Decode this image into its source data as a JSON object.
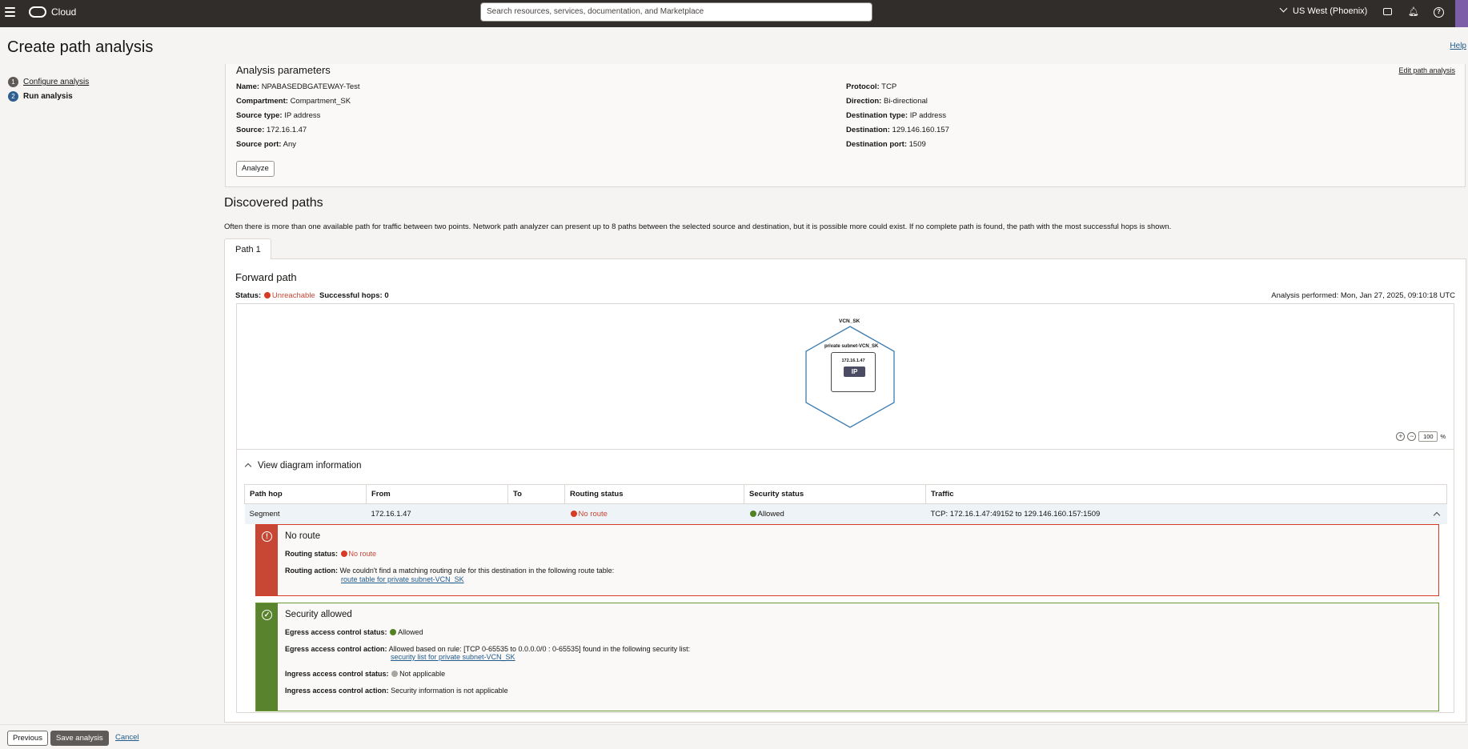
{
  "topbar": {
    "app_name": "Cloud",
    "search_placeholder": "Search resources, services, documentation, and Marketplace",
    "region": "US West (Phoenix)"
  },
  "page": {
    "title": "Create path analysis",
    "help_link": "Help"
  },
  "steps": [
    {
      "number": "1",
      "label": "Configure analysis"
    },
    {
      "number": "2",
      "label": "Run analysis"
    }
  ],
  "parameters": {
    "heading": "Analysis parameters",
    "edit_link": "Edit path analysis",
    "left": [
      {
        "label": "Name:",
        "value": "NPABASEDBGATEWAY-Test"
      },
      {
        "label": "Compartment:",
        "value": "Compartment_SK"
      },
      {
        "label": "Source type:",
        "value": "IP address"
      },
      {
        "label": "Source:",
        "value": "172.16.1.47"
      },
      {
        "label": "Source port:",
        "value": "Any"
      }
    ],
    "right": [
      {
        "label": "Protocol:",
        "value": "TCP"
      },
      {
        "label": "Direction:",
        "value": "Bi-directional"
      },
      {
        "label": "Destination type:",
        "value": "IP address"
      },
      {
        "label": "Destination:",
        "value": "129.146.160.157"
      },
      {
        "label": "Destination port:",
        "value": "1509"
      }
    ],
    "analyze_button": "Analyze"
  },
  "discovered": {
    "title": "Discovered paths",
    "description": "Often there is more than one available path for traffic between two points. Network path analyzer can present up to 8 paths between the selected source and destination, but it is possible more could exist. If no complete path is found, the path with the most successful hops is shown.",
    "tab": "Path 1",
    "forward_title": "Forward path",
    "status_label": "Status:",
    "status_value": "Unreachable",
    "hops_label": "Successful hops:",
    "hops_value": "0",
    "analysis_performed": "Analysis performed: Mon, Jan 27, 2025, 09:10:18 UTC"
  },
  "diagram": {
    "vcn": "VCN_SK",
    "subnet": "private subnet-VCN_SK",
    "ip_address": "172.16.1.47",
    "ip_tag": "IP",
    "zoom_value": "100",
    "zoom_unit": "%"
  },
  "diagram_info": {
    "toggle_label": "View diagram information",
    "columns": [
      "Path hop",
      "From",
      "To",
      "Routing status",
      "Security status",
      "Traffic"
    ],
    "row": {
      "hop": "Segment",
      "from": "172.16.1.47",
      "to": "",
      "routing": "No route",
      "security": "Allowed",
      "traffic": "TCP: 172.16.1.47:49152 to 129.146.160.157:1509"
    }
  },
  "route_card": {
    "title": "No route",
    "routing_status_label": "Routing status:",
    "routing_status_value": "No route",
    "routing_action_label": "Routing action:",
    "routing_action_text": "We couldn't find a matching routing rule for this destination in the following route table:",
    "routing_action_link": "route table for private subnet-VCN_SK"
  },
  "security_card": {
    "title": "Security allowed",
    "egress_status_label": "Egress access control status:",
    "egress_status_value": "Allowed",
    "egress_action_label": "Egress access control action:",
    "egress_action_text": "Allowed based on rule: [TCP 0-65535 to 0.0.0.0/0 : 0-65535] found in the following security list:",
    "egress_action_link": "security list for private subnet-VCN_SK",
    "ingress_status_label": "Ingress access control status:",
    "ingress_status_value": "Not applicable",
    "ingress_action_label": "Ingress access control action:",
    "ingress_action_value": "Security information is not applicable"
  },
  "footer": {
    "previous": "Previous",
    "save": "Save analysis",
    "cancel": "Cancel"
  },
  "colors": {
    "topbar": "#312d2a",
    "error": "#c74634",
    "success": "#5a832d",
    "link": "#1e5a8c"
  }
}
